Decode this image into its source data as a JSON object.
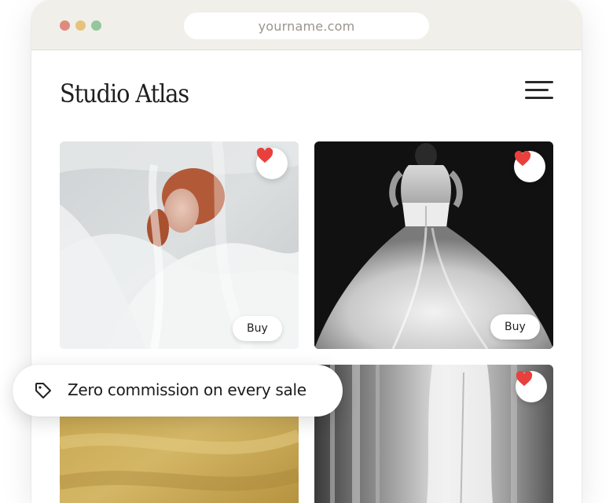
{
  "browser": {
    "url": "yourname.com"
  },
  "site": {
    "logo": "Studio Atlas",
    "menu_icon": "hamburger-menu-icon"
  },
  "gallery": {
    "items": [
      {
        "image": "woman-veiled-in-white-fabric",
        "buy_label": "Buy",
        "favorited": true
      },
      {
        "image": "bride-back-in-ballgown-bw",
        "buy_label": "Buy",
        "favorited": true
      },
      {
        "image": "golden-abstract-texture",
        "favorited": false
      },
      {
        "image": "white-suit-curtains-bw",
        "favorited": true
      }
    ]
  },
  "feature_badge": {
    "icon": "tag-icon",
    "text": "Zero commission on every sale"
  },
  "colors": {
    "heart": "#e8403c",
    "chrome": "#f1efea"
  }
}
